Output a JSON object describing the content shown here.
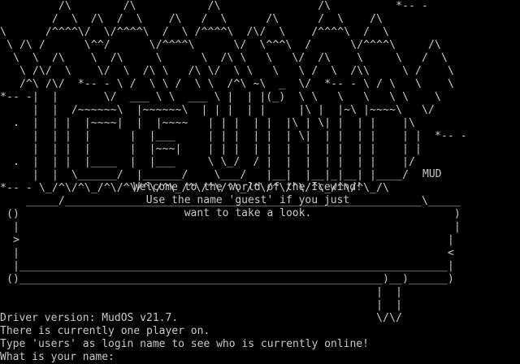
{
  "banner": {
    "art": "         /\\        /\\           /\\               /\\          *-- -\n        /  \\  /\\  /  \\    /\\   /  \\      /\\      /  \\    /\\\n\\      /^^^^\\/  \\/^^^^\\  /  \\ /^^^^\\  /\\/  \\    /^^^^\\  /  \\\n \\ /\\ /      \\^^/      \\/^^^^\\      \\/  \\^^^\\  /      \\/^^^^\\     /\\\n  \\  \\  /\\    \\  /\\     \\      \\  /\\ \\   \\   \\/  /\\    \\     \\   /  \\\n   \\ /\\/  \\    \\/  \\  /\\ \\   /\\ \\/  \\ \\   \\   \\ /  \\  /\\\\     \\ /    \\\n   /^\\ /\\/  *-- - \\ /  \\ \\ /  \\ \\  /^\\ ~\\  _  \\/  *-- - \\ / \\   \\    \\\n*-- -|  |       \\/  ___ \\ \\  ___ \\ |  | |(_)  \\ \\   \\   \\   \\ \\    \\\n     |  |  /~~~~~~\\  |~~~~~~\\  | | |  | |     |\\ |  |~\\ |~~~~\\   \\/\n  .  |  | |  |~~~~|  |  |~~~~   | | |  | |  |\\ | \\| |  | |    |\\\n     |  | |  |      |  |___     | | |  | |  | \\|  | |  | |    | |  *-- -\n     |  | |  |      |  |~~~|    | | |  | |  |  |  | |  | |    | |\n  .  |  | |  |____  |  |___     \\ \\_/  / |  |  |  | |  | |    |/\n     |  |  \\______/  |______/    \\___/   |__|  |__|_|__| |____/\n*-- - \\_/^\\/^\\_/^\\/^\\/^\\/^\\_/^\\/^\\/^\\_/^\\/^\\/^\\/^\\_/^\\/^\\_/\\\n    _____/_______________________________________________________\\_____\n ()                                                                   )\n  |                                                                   |\n  >                                                                  |\n  |                                                                  <\n  |__________________________________________________________________|\n ()________________________________________________________)__)______)\n                                                          |  |\n                                                          |  |\n                                                          \\/\\/"
  },
  "mud_label": "MUD",
  "welcome": {
    "line1": "Welcome to the world of the Icewind!",
    "line2": "Use the name 'guest' if you just",
    "line3": "want to take a look."
  },
  "console": {
    "driver_version": "Driver version: MudOS v21.7.",
    "players_online": "There is currently one player on.",
    "users_hint": "Type 'users' as login name to see who is currently online!",
    "name_prompt": "What is your name:",
    "name_value": ""
  }
}
